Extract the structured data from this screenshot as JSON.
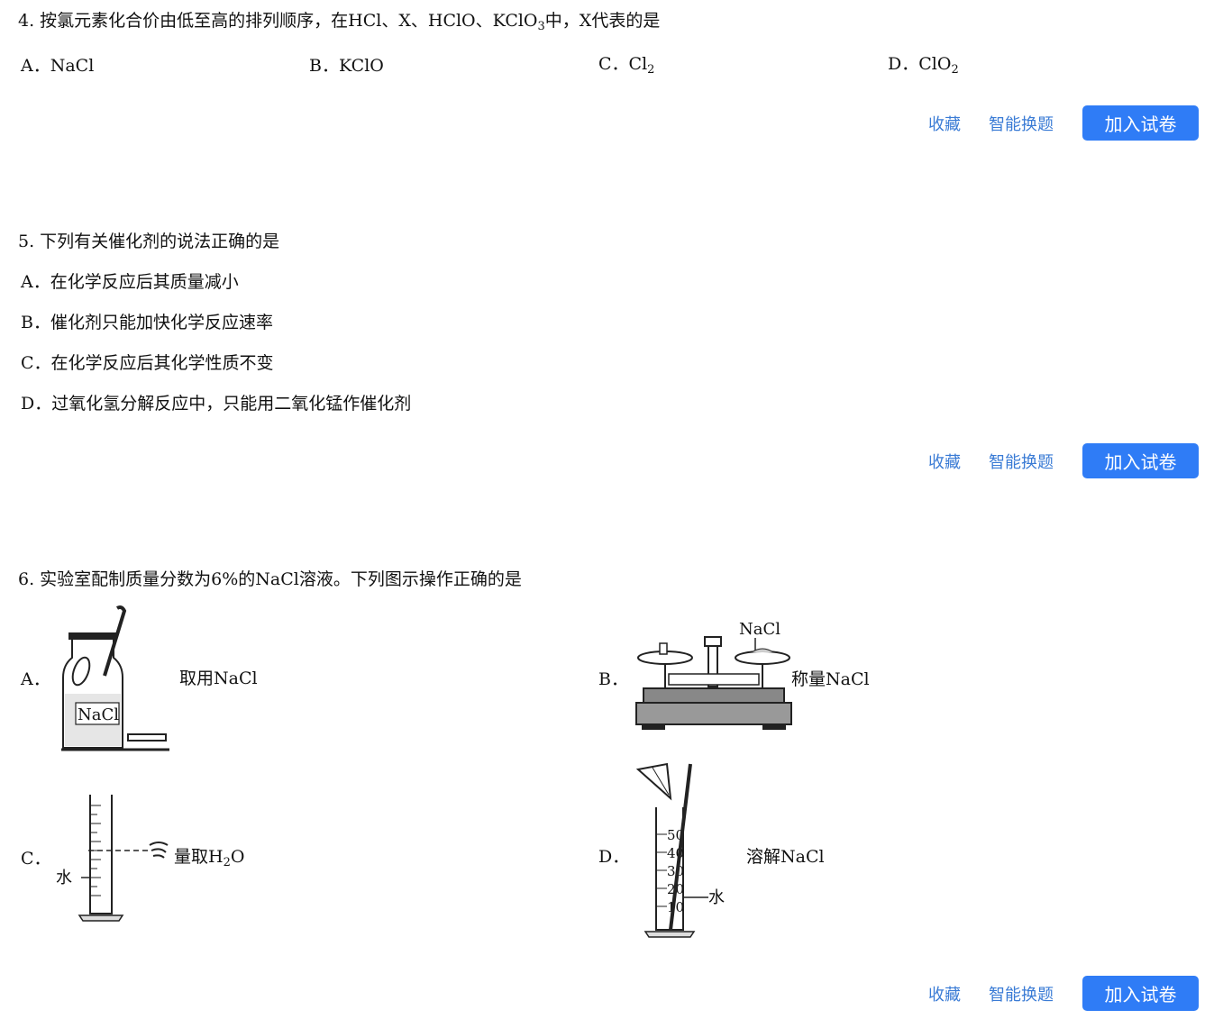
{
  "questions": [
    {
      "stem": {
        "pre": "4. 按氯元素化合价由低至高的排列顺序，在HCl、X、HClO、KClO",
        "sub": "3",
        "post": "中，X代表的是"
      },
      "options": [
        {
          "letter": "A．",
          "text": "NaCl",
          "sub": ""
        },
        {
          "letter": "B．",
          "text": "KClO",
          "sub": ""
        },
        {
          "letter": "C．",
          "text": "Cl",
          "sub": "2"
        },
        {
          "letter": "D．",
          "text": "ClO",
          "sub": "2"
        }
      ]
    },
    {
      "stem": {
        "pre": "5. 下列有关催化剂的说法正确的是"
      },
      "options": [
        {
          "letter": "A．",
          "text": "在化学反应后其质量减小"
        },
        {
          "letter": "B．",
          "text": "催化剂只能加快化学反应速率"
        },
        {
          "letter": "C．",
          "text": "在化学反应后其化学性质不变"
        },
        {
          "letter": "D．",
          "text": "过氧化氢分解反应中，只能用二氧化锰作催化剂"
        }
      ]
    },
    {
      "stem": {
        "pre": "6. 实验室配制质量分数为6%的NaCl溶液。下列图示操作正确的是"
      },
      "options": [
        {
          "letter": "A．",
          "caption": "取用NaCl",
          "figure_label": "NaCl"
        },
        {
          "letter": "B．",
          "caption": "称量NaCl",
          "figure_label": "NaCl"
        },
        {
          "letter": "C．",
          "caption_pre": "量取H",
          "caption_sub": "2",
          "caption_post": "O",
          "figure_label": "水"
        },
        {
          "letter": "D．",
          "caption": "溶解NaCl",
          "figure_label": "水",
          "scale": [
            "50",
            "40",
            "30",
            "20",
            "10"
          ]
        }
      ]
    }
  ],
  "actions": {
    "favorite": "收藏",
    "smart_swap": "智能换题",
    "add_to_paper": "加入试卷"
  },
  "colors": {
    "link": "#3a7bd5",
    "button_bg": "#2f7cf6",
    "button_text": "#ffffff"
  }
}
